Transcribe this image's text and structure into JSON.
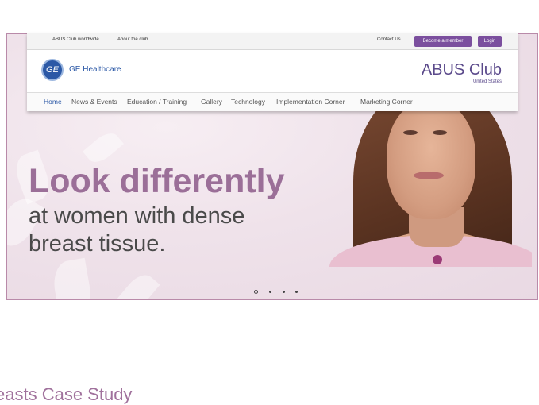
{
  "topbar": {
    "links": [
      "ABUS Club worldwide",
      "About the club",
      "Contact Us"
    ],
    "member_button": "Become a member",
    "login_button": "Login"
  },
  "brand": {
    "logo_text": "GE",
    "company": "GE Healthcare",
    "club_name": "ABUS Club",
    "region": "United States"
  },
  "nav": {
    "items": [
      "Home",
      "News & Events",
      "Education / Training",
      "Gallery",
      "Technology",
      "Implementation Corner",
      "Marketing Corner"
    ],
    "active": "Home"
  },
  "hero": {
    "headline": "Look differently",
    "line2": "at women with dense",
    "line3": "breast tissue."
  },
  "carousel": {
    "slides": 4,
    "active_slide": 1
  },
  "footer": {
    "case_study": "easts Case Study"
  },
  "colors": {
    "accent": "#9b6f98",
    "brand_blue": "#2b58a6",
    "button": "#7b4f9e"
  }
}
